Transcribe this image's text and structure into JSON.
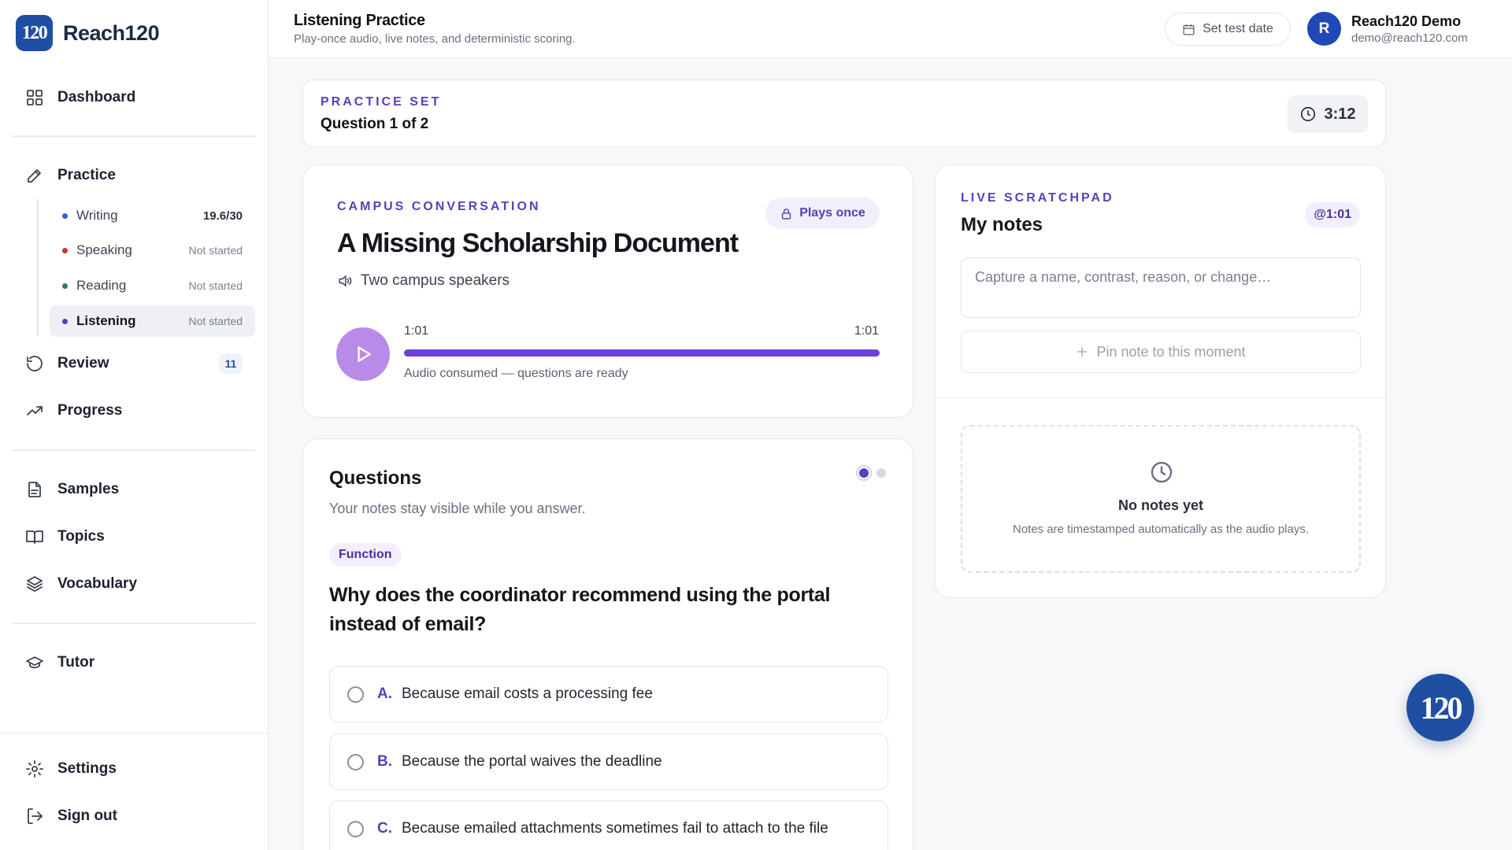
{
  "brand": {
    "logo": "120",
    "name": "Reach120"
  },
  "sidebar": {
    "nav": [
      {
        "label": "Dashboard",
        "icon": "grid-icon"
      },
      {
        "label": "Practice",
        "icon": "pencil-icon"
      },
      {
        "label": "Review",
        "icon": "rotate-icon",
        "badge": "11"
      },
      {
        "label": "Progress",
        "icon": "trending-up-icon"
      },
      {
        "label": "Samples",
        "icon": "file-text-icon"
      },
      {
        "label": "Topics",
        "icon": "book-open-icon"
      },
      {
        "label": "Vocabulary",
        "icon": "layers-icon"
      },
      {
        "label": "Tutor",
        "icon": "graduation-cap-icon"
      },
      {
        "label": "Settings",
        "icon": "gear-icon"
      },
      {
        "label": "Sign out",
        "icon": "sign-out-icon"
      }
    ],
    "practice_sub": [
      {
        "label": "Writing",
        "status": "19.6/30",
        "dot_color": "#3b5bdb"
      },
      {
        "label": "Speaking",
        "status": "Not started",
        "dot_color": "#c0392b"
      },
      {
        "label": "Reading",
        "status": "Not started",
        "dot_color": "#2f7d4f"
      },
      {
        "label": "Listening",
        "status": "Not started",
        "dot_color": "#5a3fb8"
      }
    ]
  },
  "header": {
    "title": "Listening Practice",
    "subtitle": "Play-once audio, live notes, and deterministic scoring.",
    "test_date_label": "Set test date",
    "user": {
      "initial": "R",
      "name": "Reach120 Demo",
      "email": "demo@reach120.com"
    }
  },
  "practice_set": {
    "eyebrow": "PRACTICE SET",
    "question_count": "Question 1 of 2",
    "timer": "3:12"
  },
  "audio": {
    "eyebrow": "CAMPUS CONVERSATION",
    "plays_once": "Plays once",
    "title": "A Missing Scholarship Document",
    "speakers": "Two campus speakers",
    "current_time": "1:01",
    "total_time": "1:01",
    "progress_percent": 100,
    "status": "Audio consumed — questions are ready"
  },
  "questions": {
    "heading": "Questions",
    "subheading": "Your notes stay visible while you answer.",
    "tag": "Function",
    "question": "Why does the coordinator recommend using the portal instead of email?",
    "options": [
      {
        "letter": "A.",
        "text": "Because email costs a processing fee"
      },
      {
        "letter": "B.",
        "text": "Because the portal waives the deadline"
      },
      {
        "letter": "C.",
        "text": "Because emailed attachments sometimes fail to attach to the file"
      }
    ]
  },
  "notes": {
    "eyebrow": "LIVE SCRATCHPAD",
    "title": "My notes",
    "stamp": "@1:01",
    "placeholder": "Capture a name, contrast, reason, or change…",
    "pin_label": "Pin note to this moment",
    "empty_title": "No notes yet",
    "empty_sub": "Notes are timestamped automatically as the audio plays."
  },
  "fab": {
    "label": "120"
  },
  "colors": {
    "accent": "#5a3fb8",
    "brand": "#1f4fa3",
    "progress": "#6d3fd9",
    "play_button": "#b98be8"
  }
}
